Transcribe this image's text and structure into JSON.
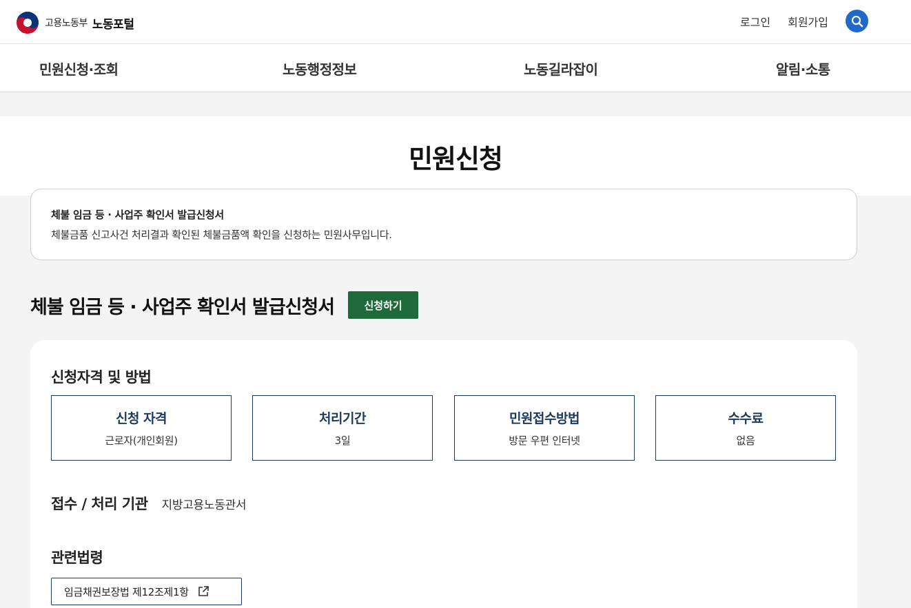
{
  "header": {
    "ministry": "고용노동부",
    "portal": "노동포털",
    "login": "로그인",
    "signup": "회원가입",
    "search_icon": "search-icon"
  },
  "nav": {
    "items": [
      "민원신청·조회",
      "노동행정정보",
      "노동길라잡이",
      "알림·소통"
    ]
  },
  "page": {
    "title": "민원신청"
  },
  "intro": {
    "title": "체불 임금 등 · 사업주 확인서 발급신청서",
    "description": "체불금품 신고사건 처리결과 확인된 체불금품액 확인을 신청하는 민원사무입니다."
  },
  "service": {
    "name": "체불 임금 등 · 사업주 확인서 발급신청서",
    "apply_label": "신청하기",
    "apply_color": "#1e6a3a"
  },
  "details": {
    "section_title": "신청자격 및 방법",
    "boxes": [
      {
        "title": "신청 자격",
        "value": "근로자(개인회원)"
      },
      {
        "title": "처리기간",
        "value": "3일"
      },
      {
        "title": "민원접수방법",
        "value": "방문 우편 인터넷"
      },
      {
        "title": "수수료",
        "value": "없음"
      }
    ],
    "org_label": "접수 / 처리 기관",
    "org_value": "지방고용노동관서",
    "law_title": "관련법령",
    "law_link": "임금채권보장법 제12조제1항",
    "law_link_icon": "external-link-icon"
  },
  "colors": {
    "accent_blue": "#1f69c8",
    "navy": "#1c3a5e",
    "green": "#1e6a3a"
  }
}
